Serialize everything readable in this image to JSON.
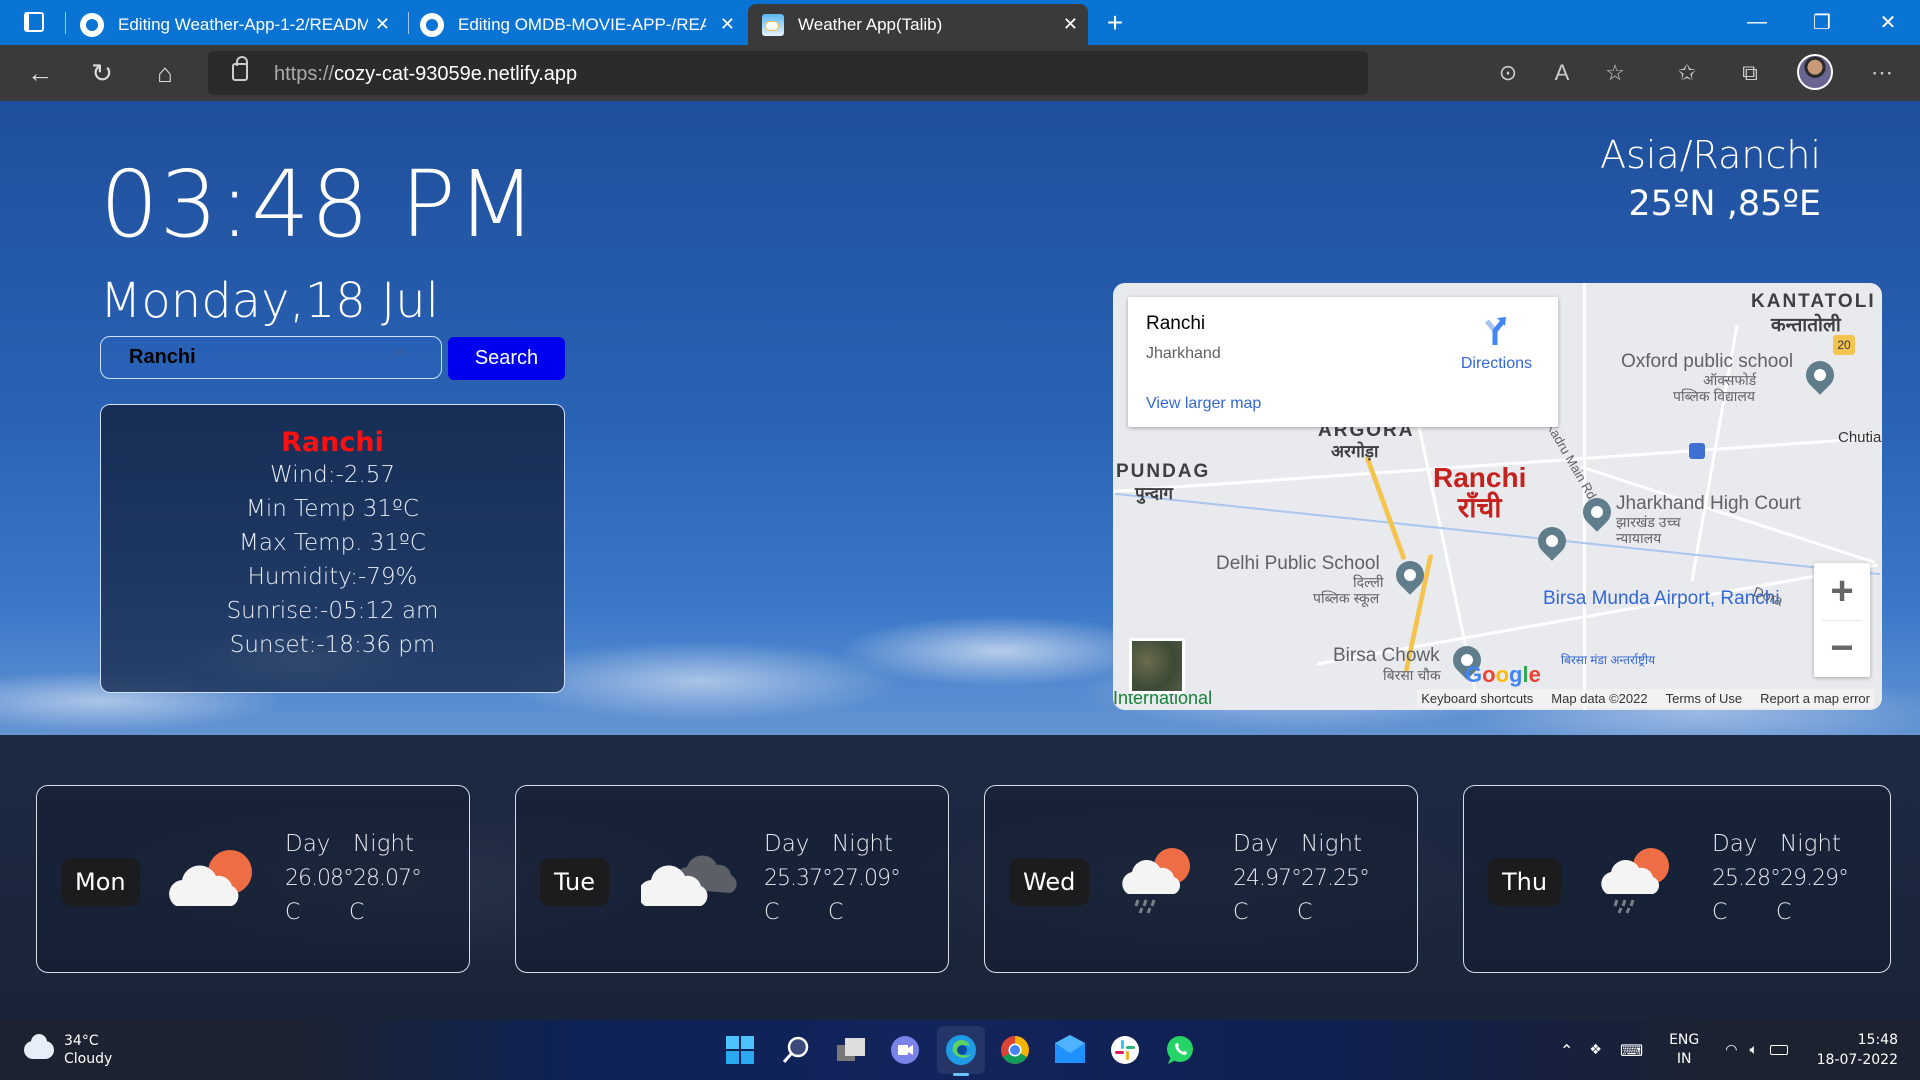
{
  "browser": {
    "tabs": [
      {
        "title": "Editing Weather-App-1-2/READM",
        "icon": "github-icon",
        "active": false
      },
      {
        "title": "Editing OMDB-MOVIE-APP-/REA",
        "icon": "github-icon",
        "active": false
      },
      {
        "title": "Weather App(Talib)",
        "icon": "weather-app-icon",
        "active": true
      }
    ],
    "new_tab_symbol": "+",
    "close_symbol": "✕",
    "url_protocol": "https://",
    "url_host": "cozy-cat-93059e.netlify.app",
    "window_controls": {
      "minimize": "—",
      "restore": "❐",
      "close": "✕"
    }
  },
  "app": {
    "clock": "03:48 PM",
    "date": "Monday,18 Jul",
    "search": {
      "value": "Ranchi",
      "button_label": "Search"
    },
    "timezone": "Asia/Ranchi",
    "coordinates": "25ºN ,85ºE",
    "current": {
      "city": "Ranchi",
      "wind": "Wind:-2.57",
      "min_temp": "Min Temp 31ºC",
      "max_temp": "Max Temp. 31ºC",
      "humidity": "Humidity:-79%",
      "sunrise": "Sunrise:-05:12 am",
      "sunset": "Sunset:-18:36 pm"
    },
    "city_color": "#ff1010",
    "search_button_color": "#0000ee"
  },
  "map": {
    "info": {
      "title": "Ranchi",
      "subtitle": "Jharkhand",
      "directions": "Directions",
      "view_larger": "View larger map"
    },
    "labels": {
      "kantatoli": "KANTATOLI",
      "kantatoli_hi": "कन्तातोली",
      "oxford": "Oxford public school",
      "oxford_hi1": "ऑक्सफोर्ड",
      "oxford_hi2": "पब्लिक विद्यालय",
      "chutia": "Chutia",
      "argora": "ARGORA",
      "argora_hi": "अरगोड़ा",
      "kadru": "Kadru Main Rd",
      "pundag": "PUNDAG",
      "pundag_hi": "पुन्दाग",
      "ranchi": "Ranchi",
      "ranchi_hi": "राँची",
      "high_court": "Jharkhand High Court",
      "high_court_hi1": "झारखंड उच्च",
      "high_court_hi2": "न्यायालय",
      "dps": "Delhi Public School",
      "dps_hi1": "दिल्ली",
      "dps_hi2": "पब्लिक स्कूल",
      "airport": "Birsa Munda Airport, Ranchi",
      "airport_hi": "बिरसा मंडा अन्तर्राष्ट्रीय",
      "birsa_chowk": "Birsa Chowk",
      "birsa_chowk_hi": "बिरसा चौक",
      "doranda": "Dora",
      "international": "International",
      "highway": "20"
    },
    "zoom_in": "+",
    "zoom_out": "−",
    "footer": {
      "keyboard": "Keyboard shortcuts",
      "data": "Map data ©2022",
      "terms": "Terms of Use",
      "report": "Report a map error"
    },
    "google": [
      "G",
      "o",
      "o",
      "g",
      "l",
      "e"
    ]
  },
  "forecast": {
    "day_label": "Day",
    "night_label": "Night",
    "unit": "C",
    "days": [
      {
        "day": "Mon",
        "day_temp": "26.08°",
        "night_temp": "28.07°",
        "icon": "partly-cloudy-icon"
      },
      {
        "day": "Tue",
        "day_temp": "25.37°",
        "night_temp": "27.09°",
        "icon": "cloudy-icon"
      },
      {
        "day": "Wed",
        "day_temp": "24.97°",
        "night_temp": "27.25°",
        "icon": "rain-sun-icon"
      },
      {
        "day": "Thu",
        "day_temp": "25.28°",
        "night_temp": "29.29°",
        "icon": "rain-sun-icon"
      }
    ]
  },
  "taskbar": {
    "weather": {
      "temp": "34°C",
      "condition": "Cloudy"
    },
    "apps": [
      "start",
      "search",
      "task-view",
      "teams",
      "edge",
      "chrome",
      "mail",
      "slack",
      "whatsapp"
    ],
    "active_app": "edge",
    "language": {
      "line1": "ENG",
      "line2": "IN"
    },
    "time": "15:48",
    "date": "18-07-2022"
  }
}
